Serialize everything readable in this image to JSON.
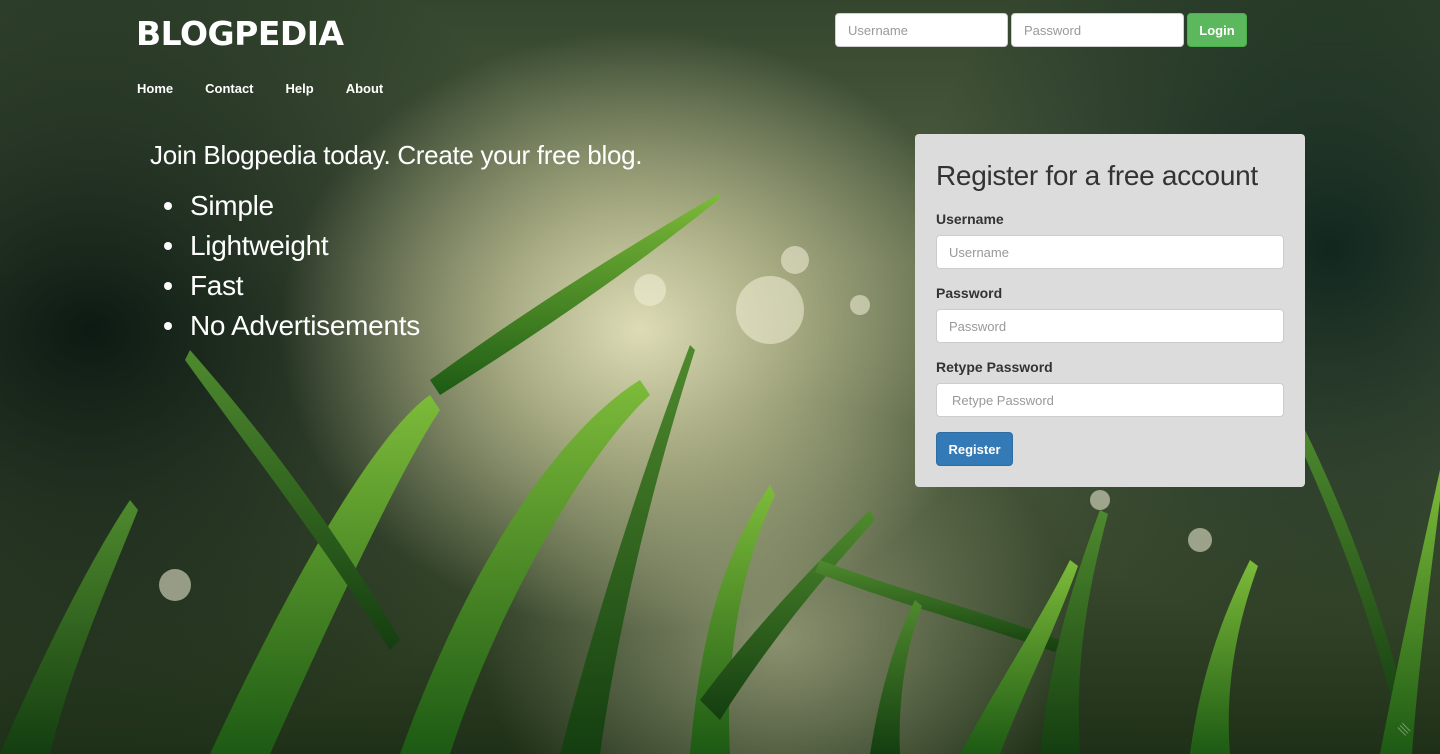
{
  "brand": {
    "logo": "BLOGPEDIA"
  },
  "nav": {
    "items": [
      {
        "label": "Home"
      },
      {
        "label": "Contact"
      },
      {
        "label": "Help"
      },
      {
        "label": "About"
      }
    ]
  },
  "header_login": {
    "username_placeholder": "Username",
    "password_placeholder": "Password",
    "login_label": "Login"
  },
  "hero": {
    "tagline": "Join Blogpedia today. Create your free blog.",
    "features": [
      "Simple",
      "Lightweight",
      "Fast",
      "No Advertisements"
    ]
  },
  "register": {
    "title": "Register for a free account",
    "username_label": "Username",
    "username_placeholder": "Username",
    "password_label": "Password",
    "password_placeholder": "Password",
    "retype_label": "Retype Password",
    "retype_placeholder": "Retype Password",
    "submit_label": "Register"
  },
  "colors": {
    "login_button": "#5cb85c",
    "register_button": "#337ab7",
    "panel_background": "#dcdcdc"
  }
}
